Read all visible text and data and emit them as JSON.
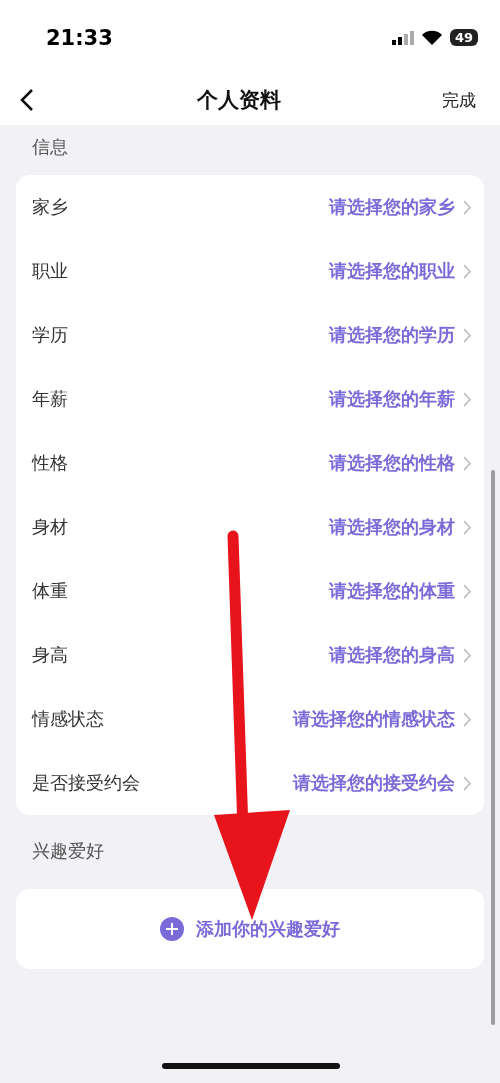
{
  "status_bar": {
    "time": "21:33",
    "battery": "49"
  },
  "nav": {
    "title": "个人资料",
    "action": "完成"
  },
  "info_section": {
    "title": "信息",
    "rows": [
      {
        "label": "家乡",
        "value": "请选择您的家乡"
      },
      {
        "label": "职业",
        "value": "请选择您的职业"
      },
      {
        "label": "学历",
        "value": "请选择您的学历"
      },
      {
        "label": "年薪",
        "value": "请选择您的年薪"
      },
      {
        "label": "性格",
        "value": "请选择您的性格"
      },
      {
        "label": "身材",
        "value": "请选择您的身材"
      },
      {
        "label": "体重",
        "value": "请选择您的体重"
      },
      {
        "label": "身高",
        "value": "请选择您的身高"
      },
      {
        "label": "情感状态",
        "value": "请选择您的情感状态"
      },
      {
        "label": "是否接受约会",
        "value": "请选择您的接受约会"
      }
    ]
  },
  "hobby_section": {
    "title": "兴趣爱好",
    "add_button": "添加你的兴趣爱好"
  }
}
